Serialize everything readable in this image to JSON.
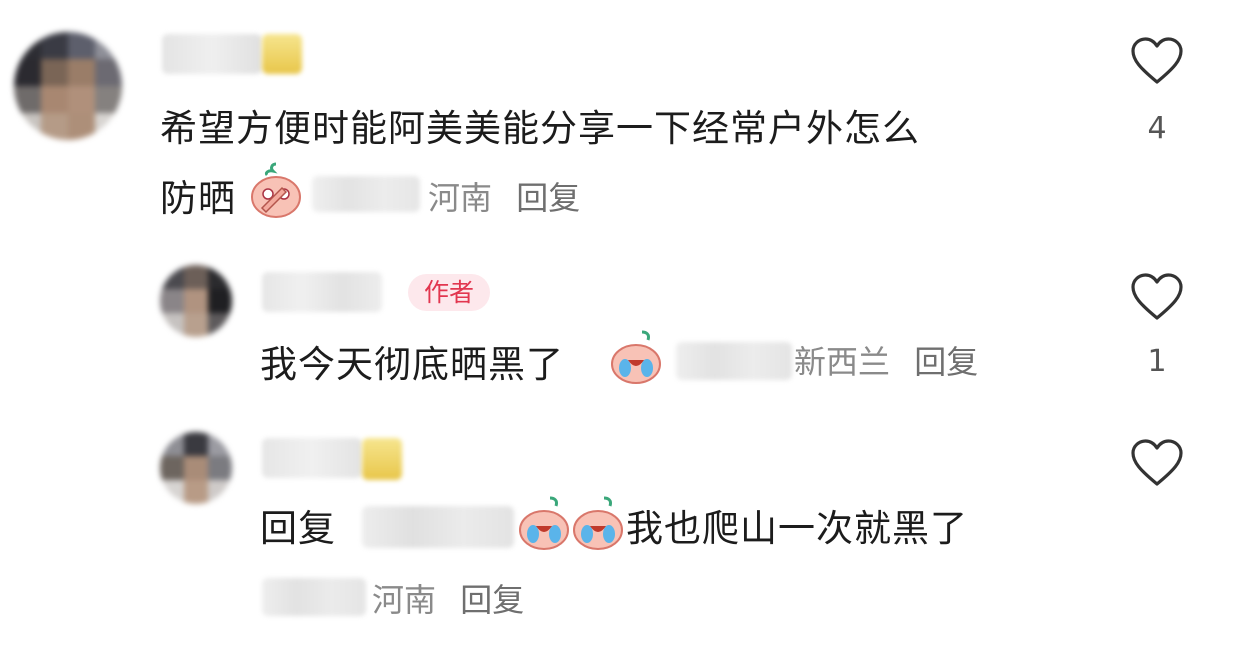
{
  "comments": [
    {
      "text_line1": "希望方便时能阿美美能分享一下经常户外怎么",
      "text_line2": "防晒",
      "location": "河南",
      "reply_label": "回复",
      "likes": "4"
    },
    {
      "author_badge": "作者",
      "text": "我今天彻底晒黑了",
      "location": "新西兰",
      "reply_label": "回复",
      "likes": "1"
    },
    {
      "prefix": "回复",
      "text": "我也爬山一次就黑了",
      "location": "河南",
      "reply_label": "回复",
      "likes": ""
    }
  ],
  "icons": {
    "like": "heart-outline-icon",
    "emoji_shy": "shy-peach-emoji",
    "emoji_cry": "crying-peach-emoji"
  },
  "colors": {
    "badge_bg": "#fde8ec",
    "badge_text": "#e2364f",
    "meta_text": "#8a8a8a"
  }
}
